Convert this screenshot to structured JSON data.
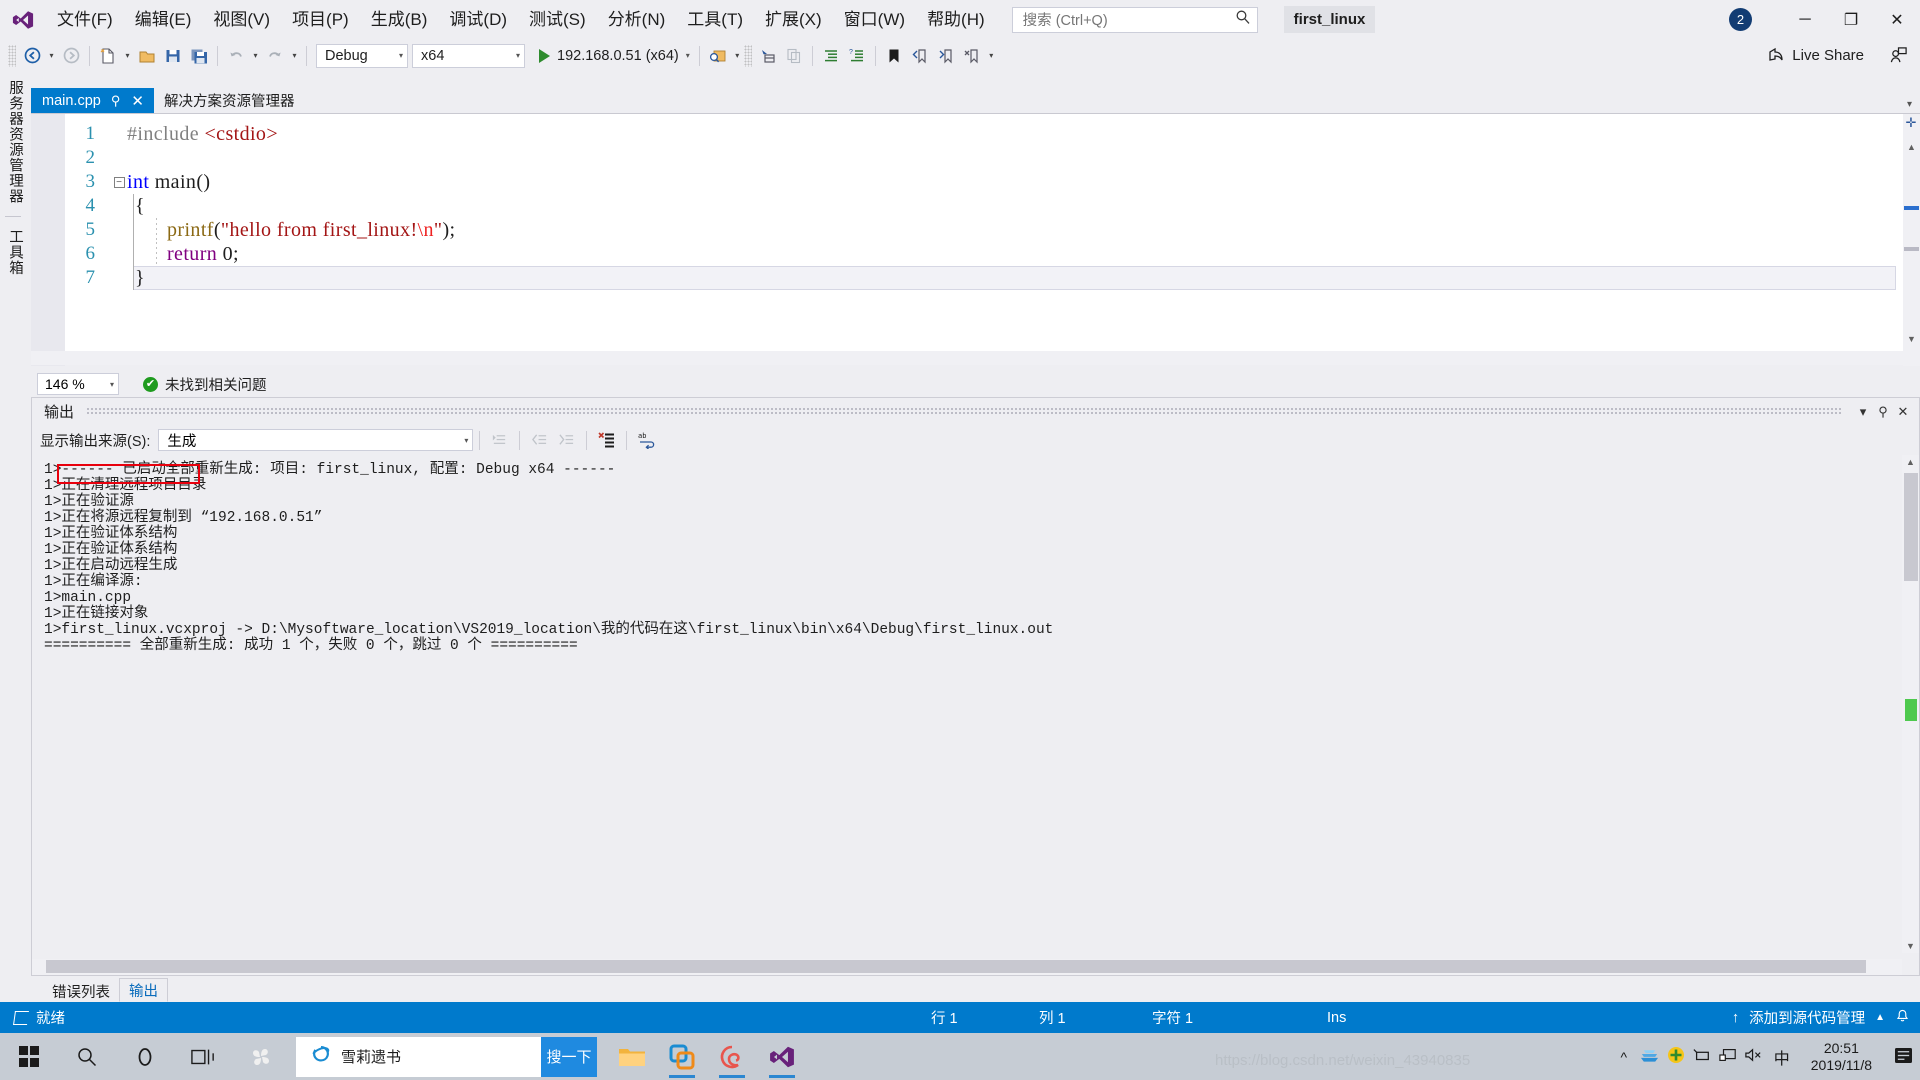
{
  "window": {
    "project_chip": "first_linux",
    "notification_count": "2",
    "live_share": "Live Share",
    "minimize": "─",
    "restore": "❐",
    "close": "✕"
  },
  "menu": {
    "items": [
      {
        "label": "文件(F)"
      },
      {
        "label": "编辑(E)"
      },
      {
        "label": "视图(V)"
      },
      {
        "label": "项目(P)"
      },
      {
        "label": "生成(B)"
      },
      {
        "label": "调试(D)"
      },
      {
        "label": "测试(S)"
      },
      {
        "label": "分析(N)"
      },
      {
        "label": "工具(T)"
      },
      {
        "label": "扩展(X)"
      },
      {
        "label": "窗口(W)"
      },
      {
        "label": "帮助(H)"
      }
    ]
  },
  "search": {
    "placeholder": "搜索 (Ctrl+Q)"
  },
  "toolbar": {
    "configuration": "Debug",
    "platform": "x64",
    "run_target": "192.168.0.51 (x64)"
  },
  "vertical_dock": {
    "tabs": [
      "服务器资源管理器",
      "工具箱"
    ]
  },
  "editor": {
    "tabs": [
      {
        "label": "main.cpp",
        "active": true
      },
      {
        "label": "解决方案资源管理器",
        "active": false
      }
    ],
    "zoom": "146 %",
    "issue_status": "未找到相关问题",
    "lines": [
      {
        "n": "1",
        "text": "#include <cstdio>"
      },
      {
        "n": "2",
        "text": ""
      },
      {
        "n": "3",
        "text": "int main()"
      },
      {
        "n": "4",
        "text": "{"
      },
      {
        "n": "5",
        "text": "printf(\"hello from first_linux!\\n\");"
      },
      {
        "n": "6",
        "text": "return 0;"
      },
      {
        "n": "7",
        "text": "}"
      }
    ]
  },
  "output": {
    "panel_title": "输出",
    "source_label": "显示输出来源(S):",
    "source_value": "生成",
    "highlight_text": "已启动全部重新生成:",
    "lines": [
      "1>------ 已启动全部重新生成: 项目: first_linux, 配置: Debug x64 ------",
      "1>正在清理远程项目目录",
      "1>正在验证源",
      "1>正在将源远程复制到 “192.168.0.51”",
      "1>正在验证体系结构",
      "1>正在验证体系结构",
      "1>正在启动远程生成",
      "1>正在编译源:",
      "1>main.cpp",
      "1>正在链接对象",
      "1>first_linux.vcxproj -> D:\\Mysoftware_location\\VS2019_location\\我的代码在这\\first_linux\\bin\\x64\\Debug\\first_linux.out",
      "========== 全部重新生成: 成功 1 个，失败 0 个，跳过 0 个 =========="
    ]
  },
  "bottom_tabs": [
    {
      "label": "错误列表",
      "selected": false
    },
    {
      "label": "输出",
      "selected": true
    }
  ],
  "status_bar": {
    "ready": "就绪",
    "row": "行 1",
    "col": "列 1",
    "char": "字符 1",
    "ins": "Ins",
    "source_control": "添加到源代码管理"
  },
  "taskbar": {
    "search_text": "雪莉遗书",
    "search_button": "搜一下",
    "time": "20:51",
    "date": "2019/11/8",
    "ime": "中"
  },
  "watermark": "https://blog.csdn.net/weixin_43940835",
  "colors": {
    "accent": "#007acc",
    "chrome": "#eeeef2",
    "highlight_red": "#e8000d",
    "success_green": "#1f9b1f",
    "taskbar": "#c6ccd4"
  }
}
